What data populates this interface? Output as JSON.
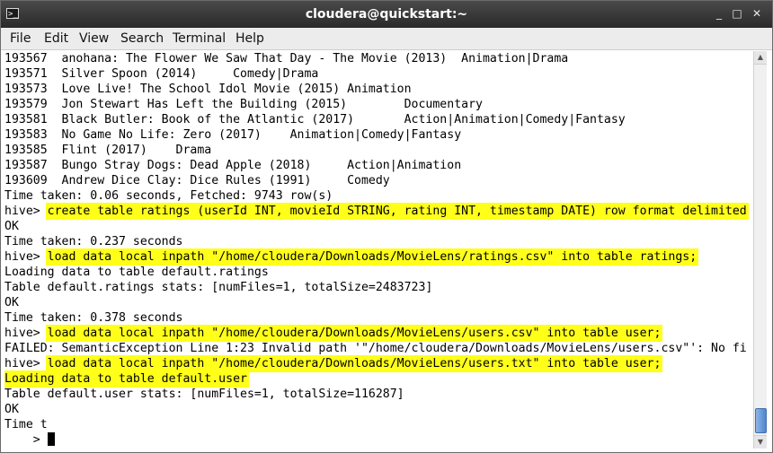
{
  "window": {
    "title": "cloudera@quickstart:~",
    "icon": "terminal-icon",
    "controls": {
      "minimize": "_",
      "maximize": "□",
      "close": "✕"
    }
  },
  "menu": [
    "File",
    "Edit",
    "View",
    "Search",
    "Terminal",
    "Help"
  ],
  "terminal": {
    "lines": [
      "193567  anohana: The Flower We Saw That Day - The Movie (2013)  Animation|Drama",
      "193571  Silver Spoon (2014)     Comedy|Drama",
      "193573  Love Live! The School Idol Movie (2015) Animation",
      "193579  Jon Stewart Has Left the Building (2015)        Documentary",
      "193581  Black Butler: Book of the Atlantic (2017)       Action|Animation|Comedy|Fantasy",
      "193583  No Game No Life: Zero (2017)    Animation|Comedy|Fantasy",
      "193585  Flint (2017)    Drama",
      "193587  Bungo Stray Dogs: Dead Apple (2018)     Action|Animation",
      "193609  Andrew Dice Clay: Dice Rules (1991)     Comedy",
      "Time taken: 0.06 seconds, Fetched: 9743 row(s)",
      "OK",
      "Time taken: 0.237 seconds",
      "Loading data to table default.ratings",
      "Table default.ratings stats: [numFiles=1, totalSize=2483723]",
      "OK",
      "Time taken: 0.378 seconds",
      "FAILED: SemanticException Line 1:23 Invalid path '\"/home/cloudera/Downloads/MovieLens/users.csv\"': No fi",
      "Loading data to table default.user",
      "Table default.user stats: [numFiles=1, totalSize=116287]",
      "OK",
      "Time t",
      "    > "
    ],
    "prompt": "hive> ",
    "commands": [
      "create table ratings (userId INT, movieId STRING, rating INT, timestamp DATE) row format delimited",
      "load data local inpath \"/home/cloudera/Downloads/MovieLens/ratings.csv\" into table ratings;",
      "load data local inpath \"/home/cloudera/Downloads/MovieLens/users.csv\" into table user;",
      "load data local inpath \"/home/cloudera/Downloads/MovieLens/users.txt\" into table user;"
    ],
    "highlight_color": "#ffff1a"
  },
  "scrollbar": {
    "up_arrow": "▲",
    "down_arrow": "▼",
    "position_fraction": 0.97
  }
}
